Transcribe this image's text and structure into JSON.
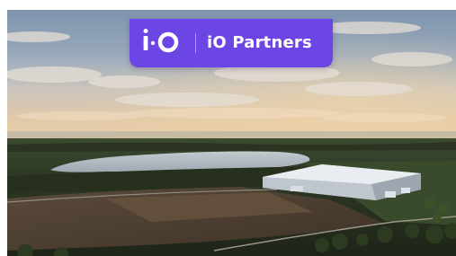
{
  "banner": {
    "logo_text": "i·O",
    "title": "iO Partners",
    "background": "#6b46e5"
  },
  "photo": {
    "description_icon": "aerial-landscape-photo"
  }
}
